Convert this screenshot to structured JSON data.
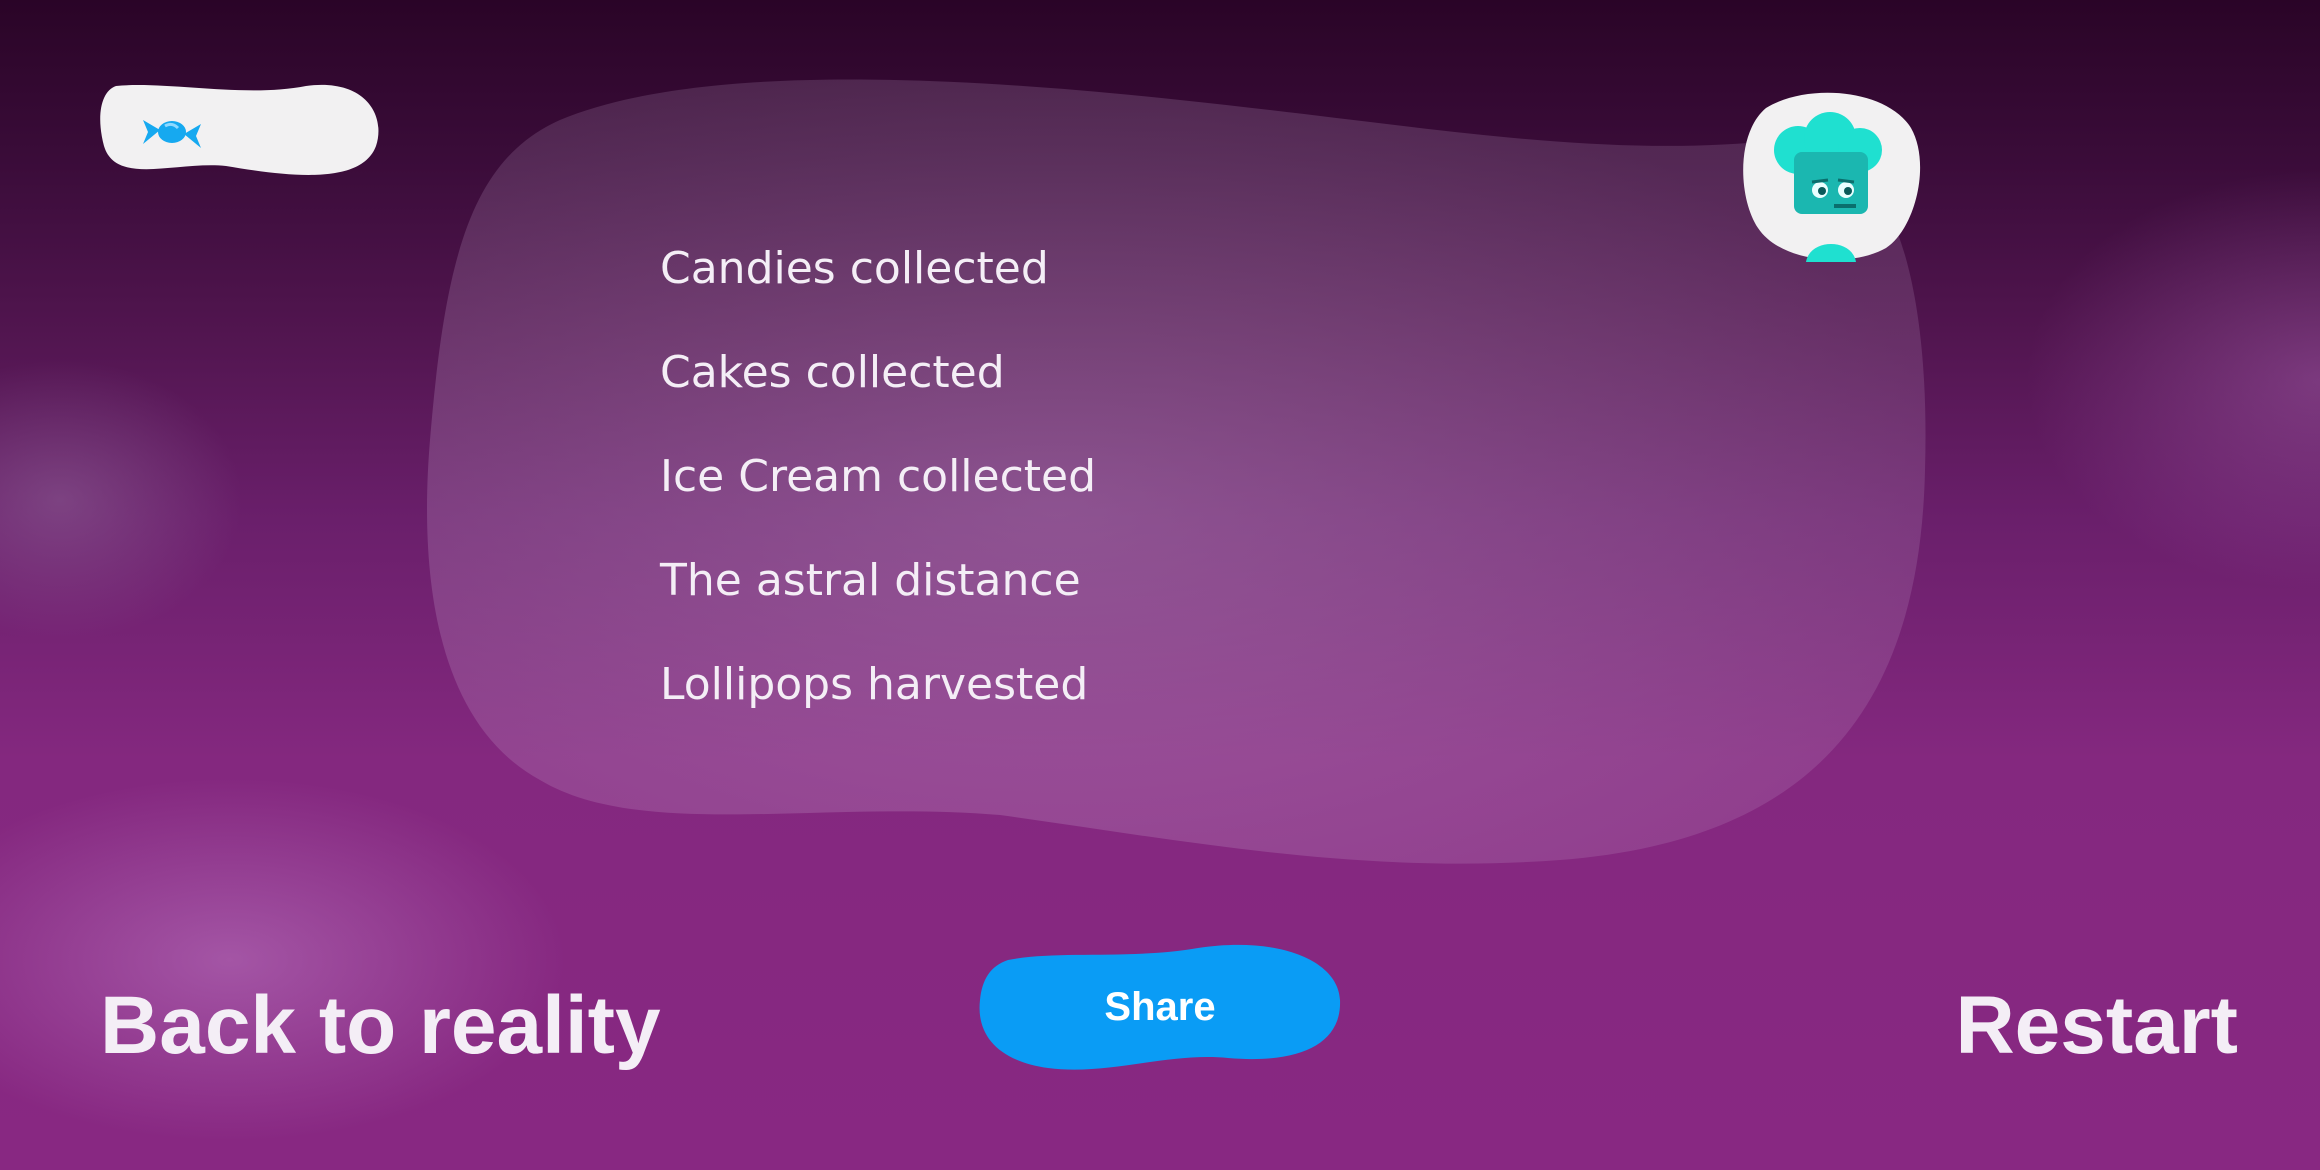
{
  "stats": [
    {
      "label": "Candies collected"
    },
    {
      "label": "Cakes collected"
    },
    {
      "label": "Ice Cream collected"
    },
    {
      "label": "The astral distance"
    },
    {
      "label": "Lollipops harvested"
    }
  ],
  "hud": {
    "candy_icon": "candy-icon",
    "avatar_icon": "teal-character-avatar"
  },
  "actions": {
    "back_label": "Back to reality",
    "share_label": "Share",
    "restart_label": "Restart"
  },
  "colors": {
    "share_button": "#0a9cf5",
    "text": "#f4eef6",
    "avatar_character": "#1bd6c9",
    "candy": "#16a9f0"
  }
}
